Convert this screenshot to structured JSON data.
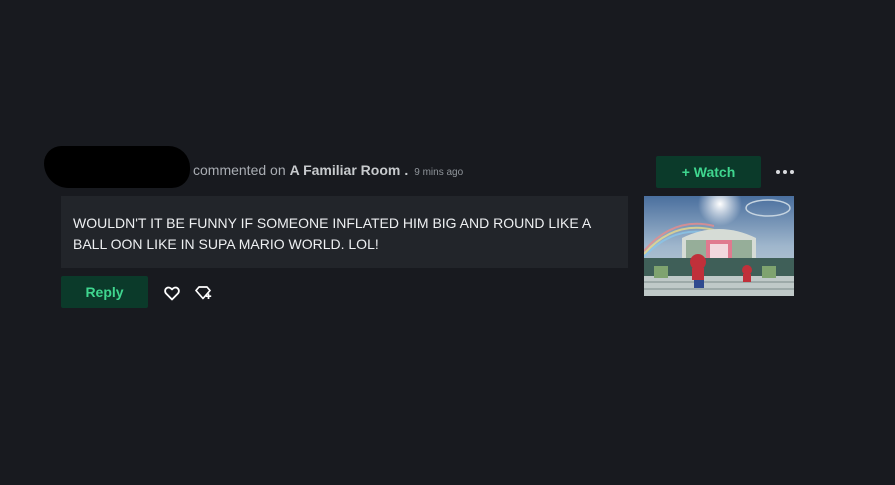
{
  "comment": {
    "action_text": "commented on",
    "deviation_title": "A Familiar Room",
    "separator": ".",
    "timestamp": "9 mins ago",
    "body": "WOULDN'T IT BE FUNNY IF SOMEONE INFLATED HIM BIG AND ROUND LIKE A BALL OON LIKE IN SUPA MARIO WORLD. LOL!"
  },
  "actions": {
    "watch_label": "+ Watch",
    "reply_label": "Reply",
    "more_icon": "more-dots-icon",
    "favourite_icon": "heart-icon",
    "badge_icon": "badge-gift-icon"
  },
  "colors": {
    "background": "#181a1f",
    "comment_bg": "#22252a",
    "button_bg": "#0b3a2a",
    "accent_green": "#3fd68f"
  }
}
